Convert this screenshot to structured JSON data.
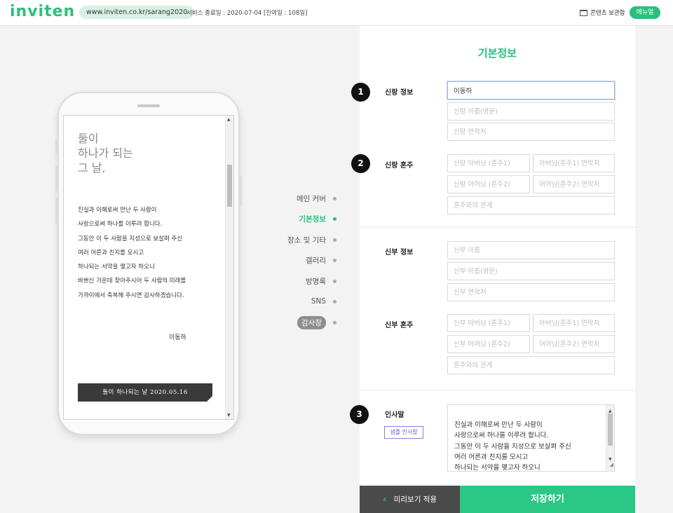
{
  "header": {
    "logo": "inviten",
    "url": "www.inviten.co.kr/sarang2020",
    "service_end": "서비스 종료일 : 2020-07-04 [잔여일 : 108일]",
    "storage_label": "콘텐츠 보관함",
    "menu_label": "메뉴얼"
  },
  "preview": {
    "headline": "둘이\n하나가 되는\n그 날,",
    "body": "진실과 이해로써 만난 두 사람이\n사랑으로써 하나를 이루려 합니다.\n그동안 이 두 사람을 지성으로 보살펴 주신\n여러 어른과 친지를 모시고\n하나되는 서약을 맺고자 하오니\n바쁘신 가운데 찾아주시어 두 사람의 미래를\n가까이에서 축복해 주시면 감사하겠습니다.",
    "signature": "이동하",
    "banner": "둘이 하나되는 날  2020.05.16"
  },
  "nav": {
    "items": [
      {
        "label": "메인 커버"
      },
      {
        "label": "기본정보"
      },
      {
        "label": "장소 및 기타"
      },
      {
        "label": "갤러리"
      },
      {
        "label": "방명록"
      },
      {
        "label": "SNS"
      },
      {
        "label": "감사장"
      }
    ],
    "active_index": 1
  },
  "form": {
    "title": "기본정보",
    "badges": [
      "1",
      "2",
      "3"
    ],
    "groom_info": {
      "label": "신랑 정보",
      "name_value": "이동하",
      "name_en_placeholder": "신랑 이름(영문)",
      "phone_placeholder": "신랑 연락처"
    },
    "groom_parents": {
      "label": "신랑 혼주",
      "father_placeholder": "신랑 아버님 (혼주1)",
      "father_phone_placeholder": "아버님(혼주1) 연락처",
      "mother_placeholder": "신랑 어머님 (혼주2)",
      "mother_phone_placeholder": "어머님(혼주2) 연락처",
      "relation_placeholder": "혼주와의 관계"
    },
    "bride_info": {
      "label": "신부 정보",
      "name_placeholder": "신부 이름",
      "name_en_placeholder": "신부 이름(영문)",
      "phone_placeholder": "신부 연락처"
    },
    "bride_parents": {
      "label": "신부 혼주",
      "father_placeholder": "신부 아버님 (혼주1)",
      "father_phone_placeholder": "아버님(혼주1) 연락처",
      "mother_placeholder": "신부 어머님 (혼주2)",
      "mother_phone_placeholder": "어머님(혼주2) 연락처",
      "relation_placeholder": "혼주와의 관계"
    },
    "greeting": {
      "label": "인사말",
      "sample_button": "샘플 인사말",
      "text": "진실과 이해로써 만난 두 사람이\n사랑으로써 하나를 이루려 합니다.\n그동안 이 두 사람을 지성으로 보살펴 주신\n여러 어른과 친지를 모시고\n하나되는 서약을 맺고자 하오니\n바쁘신 가운데 찾아주시어 두 사람의 미래를"
    }
  },
  "footer": {
    "preview_label": "미리보기 적용",
    "save_label": "저장하기"
  },
  "colors": {
    "accent": "#2bbf7e",
    "dark": "#4a4a4a"
  }
}
